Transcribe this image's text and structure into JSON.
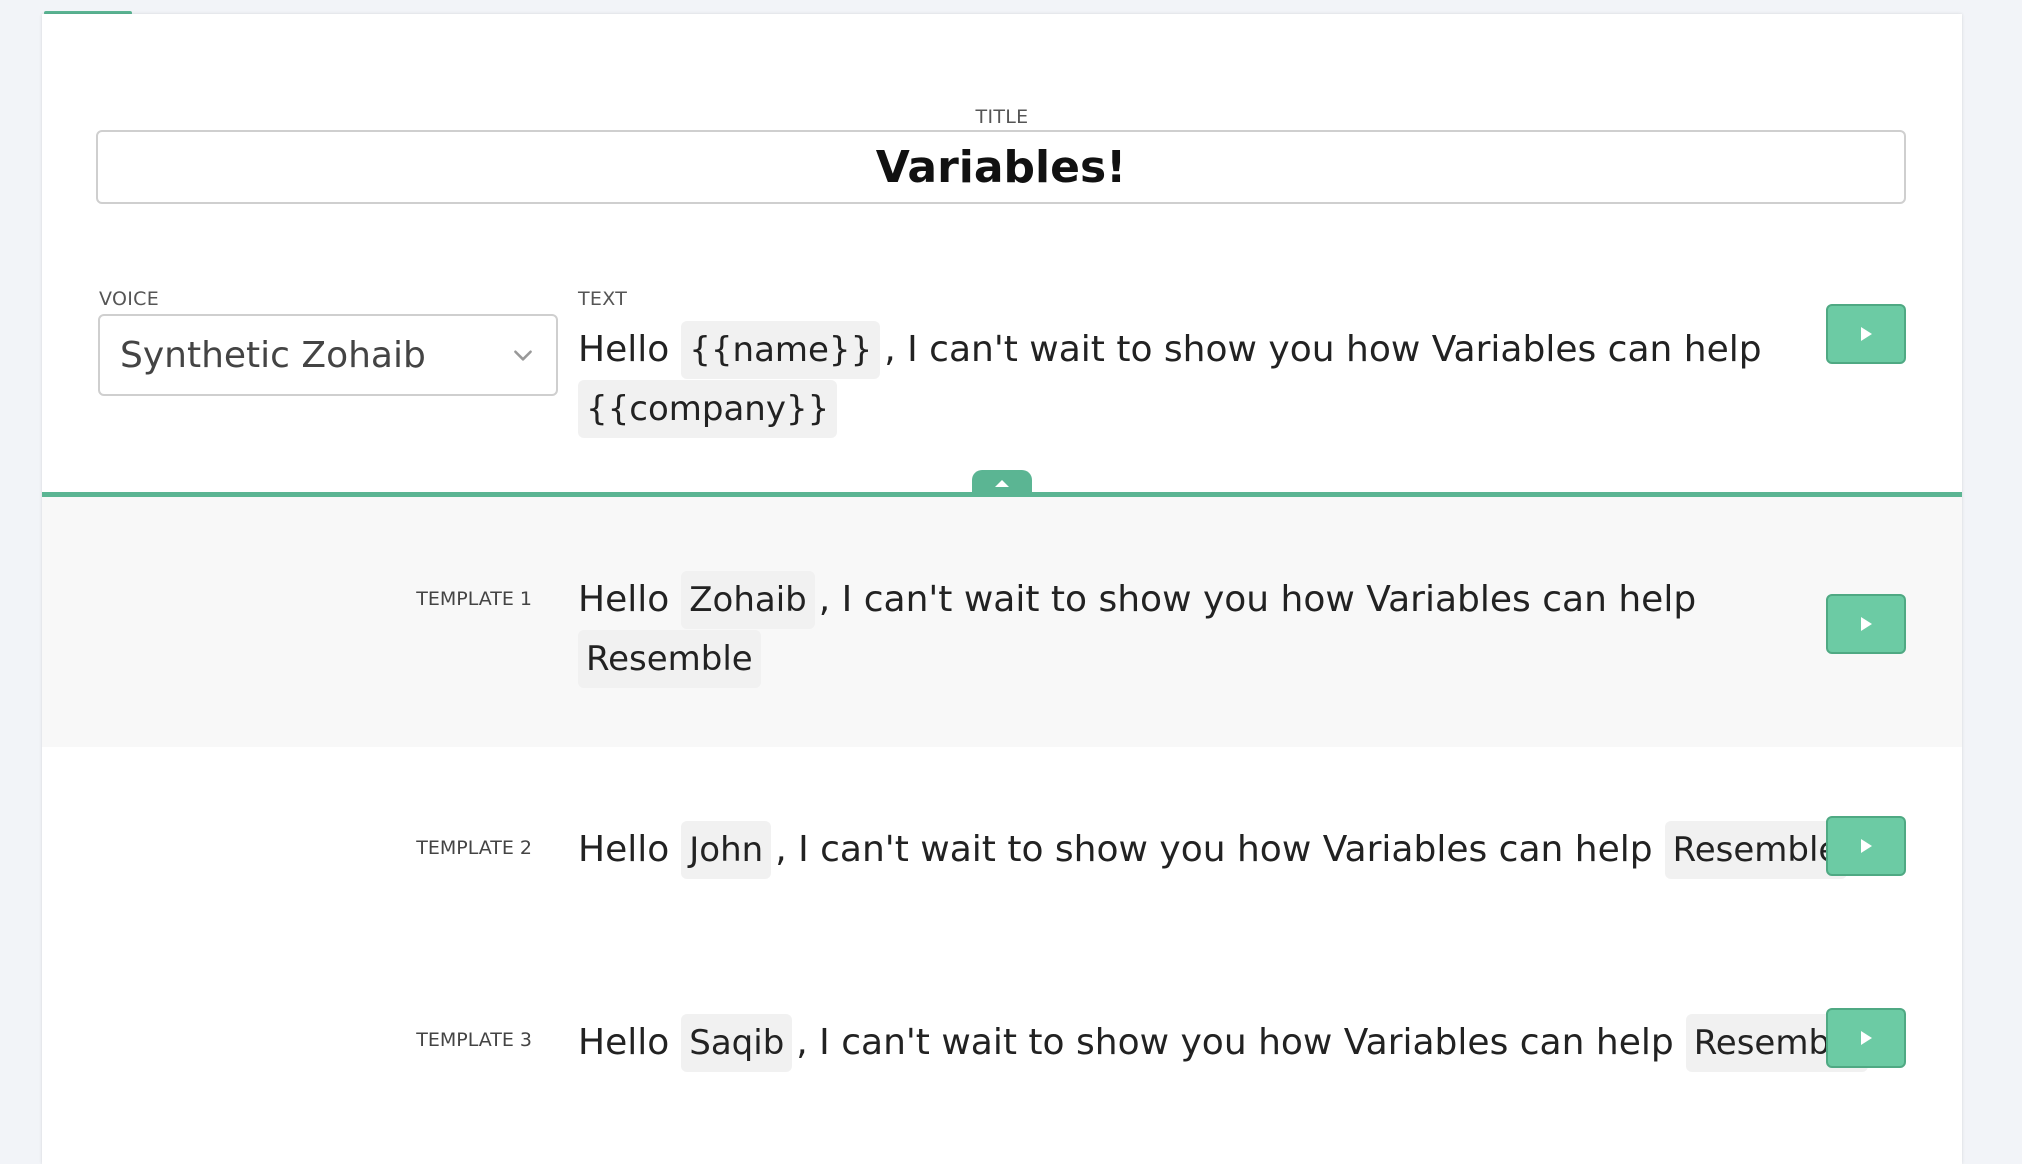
{
  "title": {
    "label": "TITLE",
    "value": "Variables!"
  },
  "voice": {
    "label": "VOICE",
    "selected": "Synthetic Zohaib"
  },
  "text": {
    "label": "TEXT",
    "greeting": "Hello",
    "var_name": "{{name}}",
    "body": ", I can't wait to show you how Variables can help",
    "var_company": "{{company}}"
  },
  "templates": [
    {
      "label": "TEMPLATE 1",
      "greeting": "Hello",
      "name": "Zohaib",
      "body": ", I can't wait to show you how Variables can help",
      "company": "Resemble"
    },
    {
      "label": "TEMPLATE 2",
      "greeting": "Hello",
      "name": "John",
      "body": ", I can't wait to show you how Variables can help",
      "company": "Resemble"
    },
    {
      "label": "TEMPLATE 3",
      "greeting": "Hello",
      "name": "Saqib",
      "body": ", I can't wait to show you how Variables can help",
      "company": "Resemble"
    }
  ],
  "icons": {
    "play": "play-icon",
    "chevron": "chevron-down-icon",
    "collapse": "collapse-up-icon"
  },
  "colors": {
    "accent": "#5bb593",
    "button": "#6ccba4",
    "chip": "#f1f1f1"
  }
}
